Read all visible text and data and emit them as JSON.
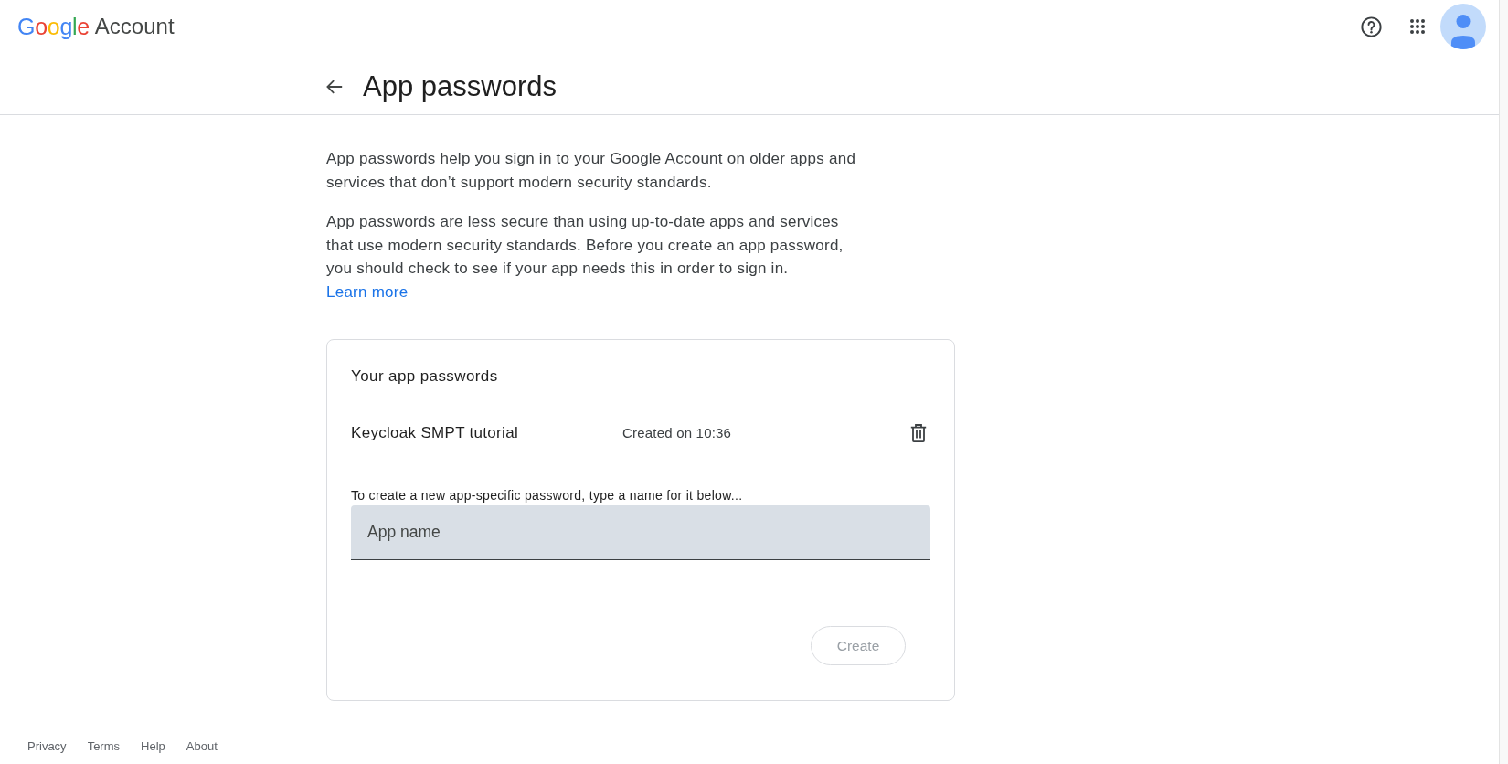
{
  "header": {
    "brand": "Google",
    "product": "Account"
  },
  "page": {
    "title": "App passwords"
  },
  "intro": {
    "paragraphs": [
      "App passwords help you sign in to your Google Account on older apps and services that don’t support modern security standards.",
      "App passwords are less secure than using up-to-date apps and services that use modern security standards. Before you create an app password, you should check to see if your app needs this in order to sign in."
    ],
    "link": "Learn more"
  },
  "passwords_card": {
    "title": "Your app passwords",
    "items": [
      {
        "name": "Keycloak SMPT tutorial",
        "created": "Created on 10:36"
      }
    ],
    "instruction": "To create a new app-specific password, type a name for it below...",
    "app_name_field": {
      "placeholder": "App name"
    },
    "create_button": {
      "label": "Create",
      "disabled": true
    }
  },
  "footer": {
    "links": [
      "Privacy",
      "Terms",
      "Help",
      "About"
    ]
  }
}
